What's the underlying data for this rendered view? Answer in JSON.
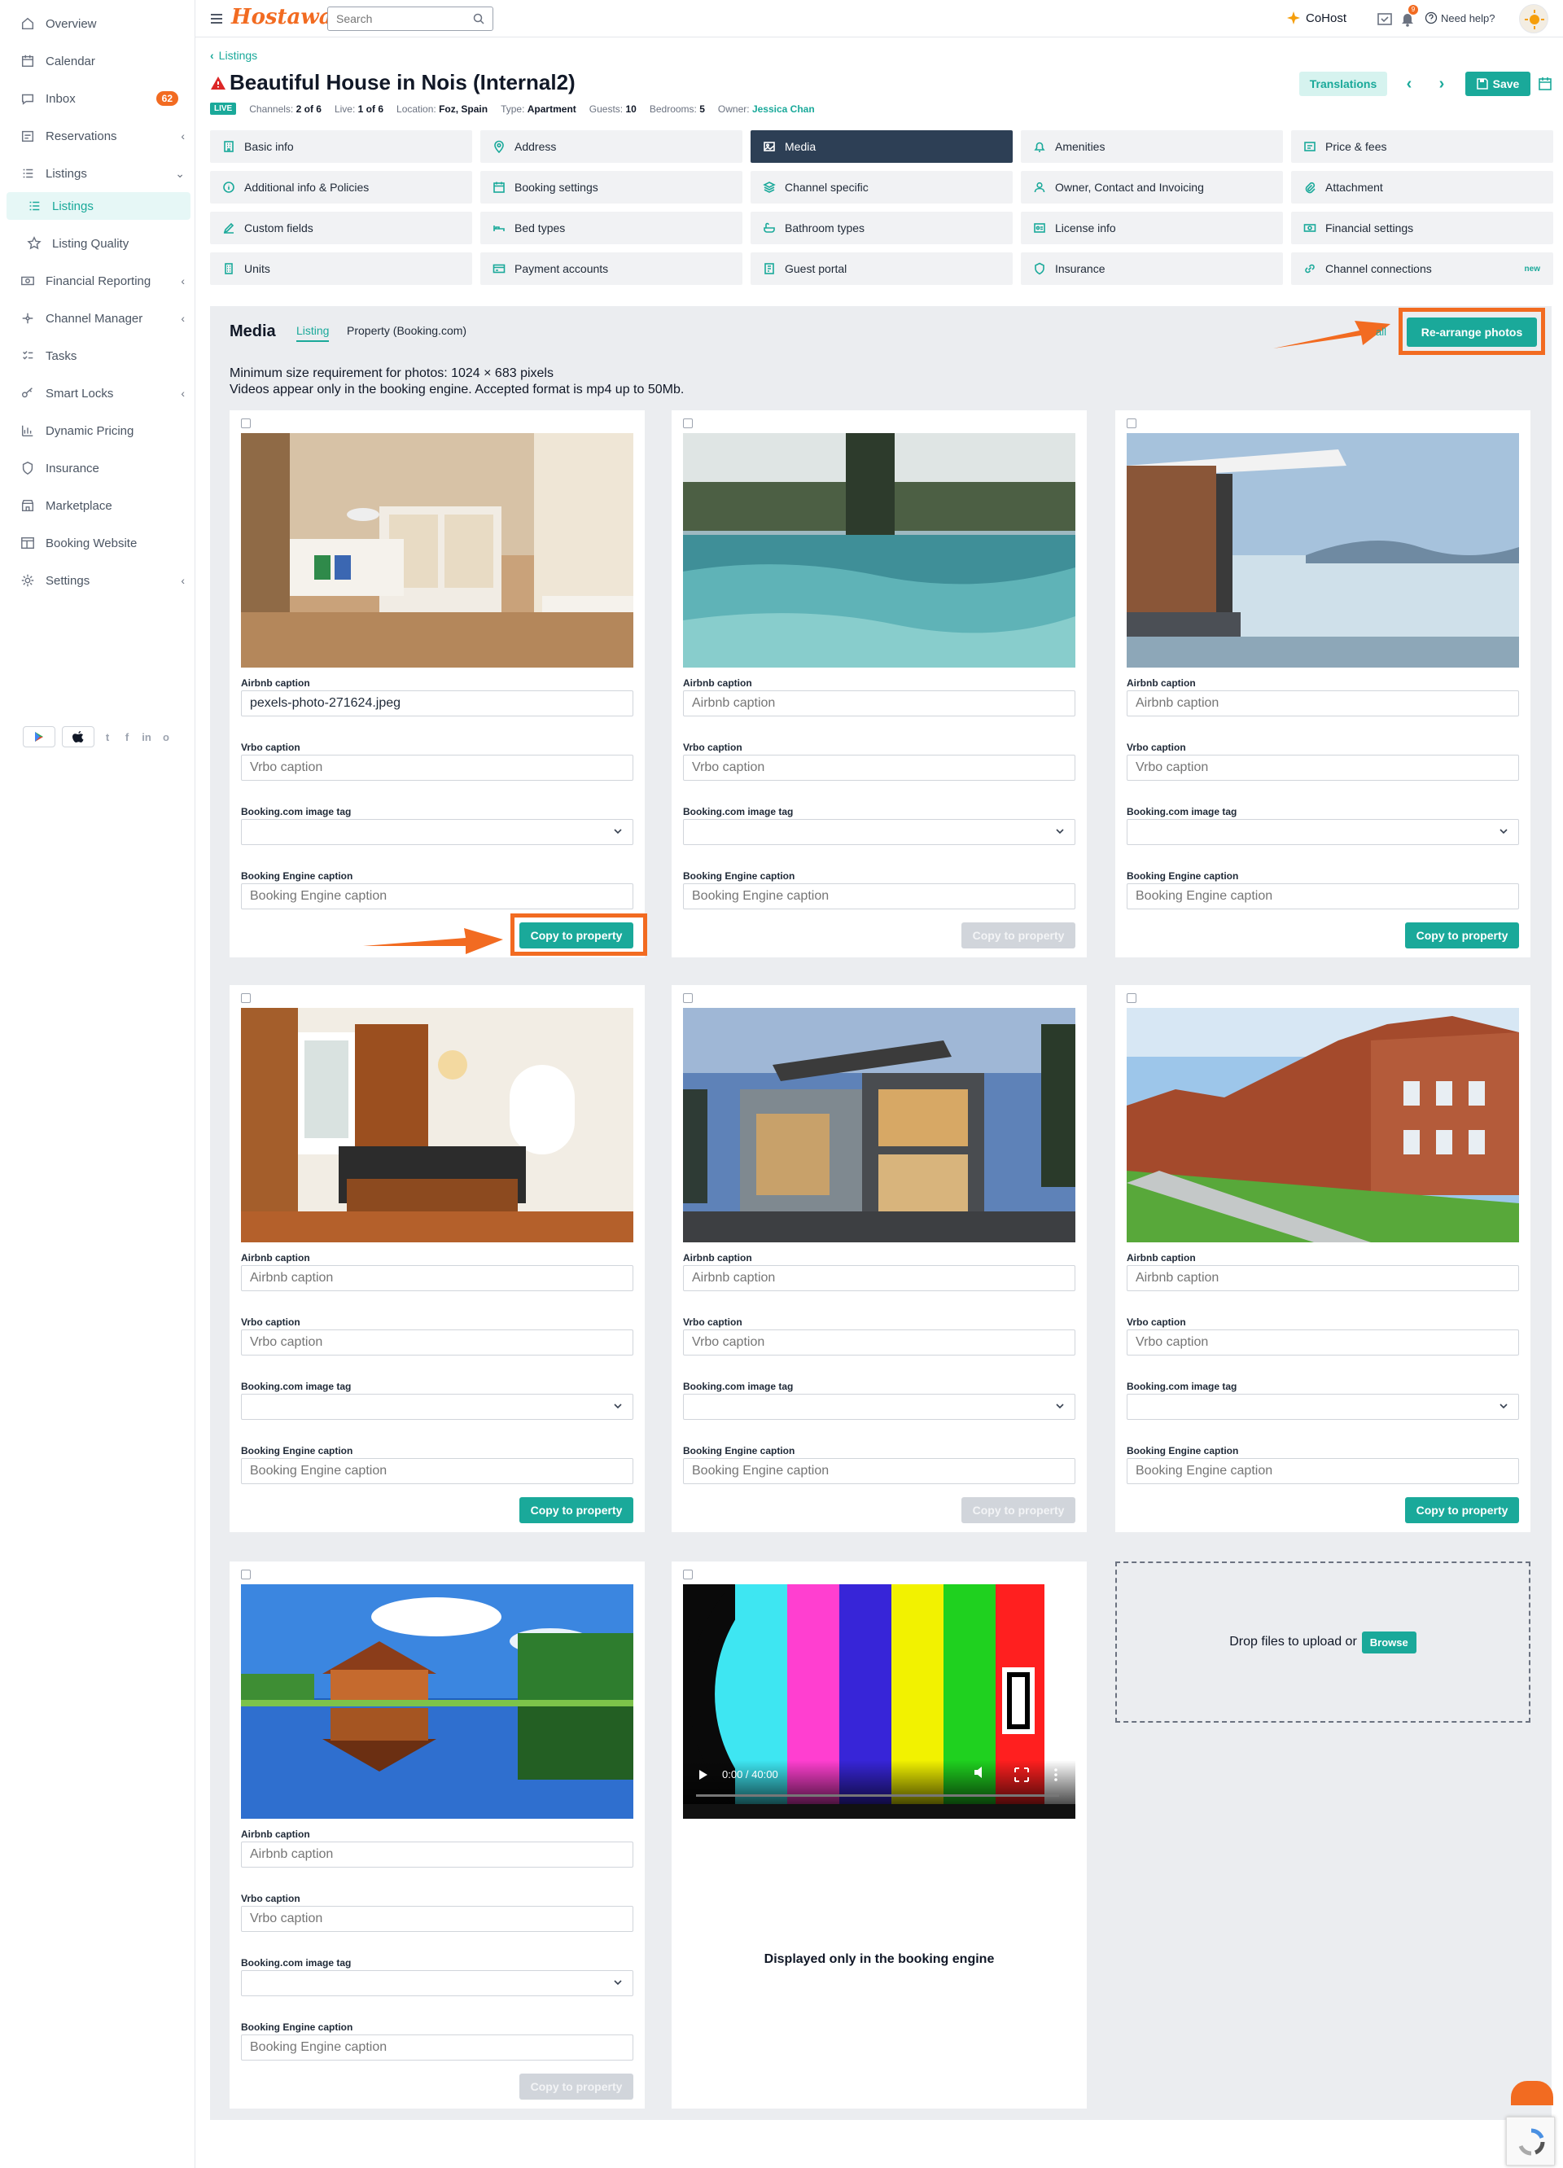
{
  "topbar": {
    "logo": "Hostaway",
    "search_placeholder": "Search",
    "cohost": "CoHost",
    "notif_count": "9",
    "help": "Need help?"
  },
  "sidebar": {
    "items": [
      {
        "label": "Overview",
        "icon": "home-icon"
      },
      {
        "label": "Calendar",
        "icon": "calendar-icon"
      },
      {
        "label": "Inbox",
        "icon": "inbox-icon",
        "badge": "62"
      },
      {
        "label": "Reservations",
        "icon": "reservations-icon"
      },
      {
        "label": "Listings",
        "icon": "list-icon"
      },
      {
        "label": "Listings",
        "icon": "list-icon"
      },
      {
        "label": "Listing Quality",
        "icon": "star-icon"
      },
      {
        "label": "Financial Reporting",
        "icon": "money-icon"
      },
      {
        "label": "Channel Manager",
        "icon": "channel-icon"
      },
      {
        "label": "Tasks",
        "icon": "tasks-icon"
      },
      {
        "label": "Smart Locks",
        "icon": "key-icon"
      },
      {
        "label": "Dynamic Pricing",
        "icon": "pricing-icon"
      },
      {
        "label": "Insurance",
        "icon": "insurance-icon"
      },
      {
        "label": "Marketplace",
        "icon": "market-icon"
      },
      {
        "label": "Booking Website",
        "icon": "website-icon"
      },
      {
        "label": "Settings",
        "icon": "gear-icon"
      }
    ],
    "social": [
      "t",
      "f",
      "in",
      "o"
    ]
  },
  "header": {
    "breadcrumb": "Listings",
    "title": "Beautiful House in Nois (Internal2)",
    "live": "LIVE",
    "meta": [
      {
        "label": "Channels:",
        "value": "2 of 6"
      },
      {
        "label": "Live:",
        "value": "1 of 6"
      },
      {
        "label": "Location:",
        "value": "Foz, Spain"
      },
      {
        "label": "Type:",
        "value": "Apartment"
      },
      {
        "label": "Guests:",
        "value": "10"
      },
      {
        "label": "Bedrooms:",
        "value": "5"
      },
      {
        "label": "Owner:",
        "value": "Jessica Chan"
      }
    ],
    "translations": "Translations",
    "save": "Save"
  },
  "tabs": [
    {
      "label": "Basic info",
      "icon": "building-icon"
    },
    {
      "label": "Address",
      "icon": "pin-icon"
    },
    {
      "label": "Media",
      "icon": "image-icon",
      "active": true
    },
    {
      "label": "Amenities",
      "icon": "bell-icon"
    },
    {
      "label": "Price & fees",
      "icon": "price-icon"
    },
    {
      "label": "Additional info & Policies",
      "icon": "info-icon"
    },
    {
      "label": "Booking settings",
      "icon": "calendar-icon"
    },
    {
      "label": "Channel specific",
      "icon": "layers-icon"
    },
    {
      "label": "Owner, Contact and Invoicing",
      "icon": "user-icon"
    },
    {
      "label": "Attachment",
      "icon": "clip-icon"
    },
    {
      "label": "Custom fields",
      "icon": "edit-icon"
    },
    {
      "label": "Bed types",
      "icon": "bed-icon"
    },
    {
      "label": "Bathroom types",
      "icon": "bath-icon"
    },
    {
      "label": "License info",
      "icon": "license-icon"
    },
    {
      "label": "Financial settings",
      "icon": "money-icon"
    },
    {
      "label": "Units",
      "icon": "units-icon"
    },
    {
      "label": "Payment accounts",
      "icon": "card-icon"
    },
    {
      "label": "Guest portal",
      "icon": "portal-icon"
    },
    {
      "label": "Insurance",
      "icon": "insurance-icon"
    },
    {
      "label": "Channel connections",
      "icon": "link-icon",
      "badge": "new"
    }
  ],
  "media": {
    "title": "Media",
    "tab_listing": "Listing",
    "tab_property": "Property (Booking.com)",
    "select_all": "all",
    "rearrange": "Re-arrange photos",
    "info1": "Minimum size requirement for photos: 1024 × 683 pixels",
    "info2": "Videos appear only in the booking engine. Accepted format is mp4 up to 50Mb.",
    "labels": {
      "airbnb": "Airbnb caption",
      "vrbo": "Vrbo caption",
      "booking_tag": "Booking.com image tag",
      "engine": "Booking Engine caption"
    },
    "placeholders": {
      "airbnb": "Airbnb caption",
      "vrbo": "Vrbo caption",
      "engine": "Booking Engine caption"
    },
    "copy_label": "Copy to property",
    "photos": [
      {
        "image": "bedroom-photo",
        "airbnb_value": "pexels-photo-271624.jpeg",
        "copy_enabled": true
      },
      {
        "image": "pool-photo",
        "airbnb_value": "",
        "copy_enabled": false
      },
      {
        "image": "lake-house-photo",
        "airbnb_value": "",
        "copy_enabled": true
      },
      {
        "image": "kitchen-photo",
        "airbnb_value": "",
        "copy_enabled": true
      },
      {
        "image": "modern-house-photo",
        "airbnb_value": "",
        "copy_enabled": false
      },
      {
        "image": "townhouses-photo",
        "airbnb_value": "",
        "copy_enabled": true
      },
      {
        "image": "cabin-reflection-photo",
        "airbnb_value": "",
        "copy_enabled": false
      }
    ],
    "video": {
      "time": "0:00 / 40:00",
      "note": "Displayed only in the booking engine"
    },
    "drop_text": "Drop files to upload or",
    "browse": "Browse"
  },
  "colors": {
    "accent": "#1aa99a",
    "brand": "#f26b21",
    "active_tab": "#2d3f55"
  }
}
